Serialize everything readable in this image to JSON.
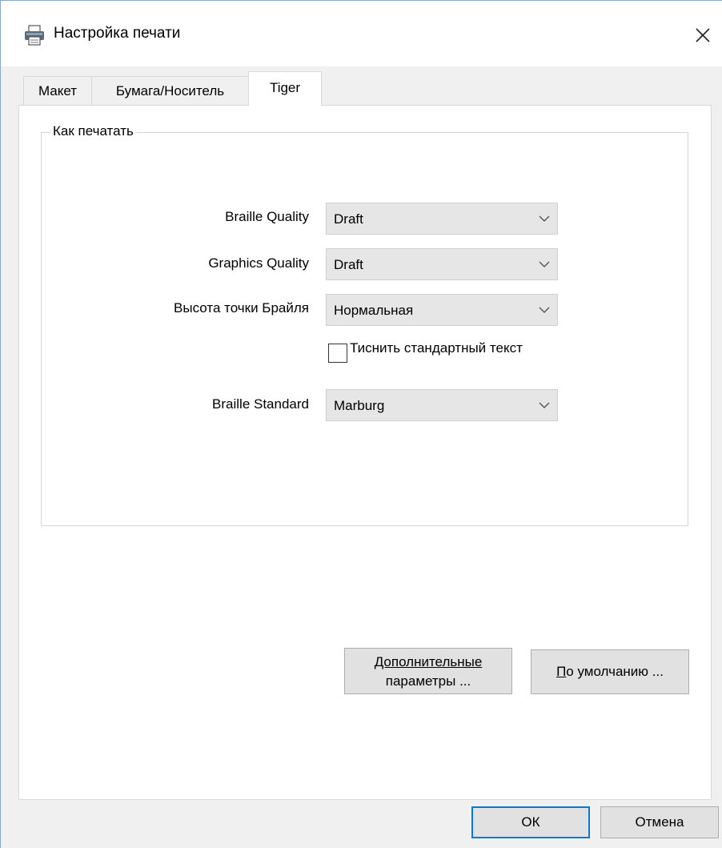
{
  "window": {
    "title": "Настройка печати",
    "title_icon": "printer-icon",
    "close_icon": "close-icon"
  },
  "tabs": [
    {
      "label": "Макет",
      "active": false
    },
    {
      "label": "Бумага/Носитель",
      "active": false
    },
    {
      "label": "Tiger",
      "active": true
    }
  ],
  "group": {
    "title": "Как печатать"
  },
  "fields": {
    "braille_quality": {
      "label": "Braille Quality",
      "value": "Draft"
    },
    "graphics_quality": {
      "label": "Graphics Quality",
      "value": "Draft"
    },
    "dot_height": {
      "label": "Высота точки Брайля",
      "value": "Нормальная"
    },
    "emboss_standard_text": {
      "label": "Тиснить стандартный текст",
      "checked": false
    },
    "braille_standard": {
      "label": "Braille Standard",
      "value": "Marburg"
    }
  },
  "buttons": {
    "advanced_line1": "Дополнительные",
    "advanced_line2": "параметры ...",
    "defaults_first": "П",
    "defaults_rest": "о умолчанию ...",
    "ok": "ОК",
    "cancel": "Отмена"
  },
  "colors": {
    "accent": "#0078d7",
    "dialog_bg": "#f0f0f0",
    "select_bg": "#e6e6e6"
  }
}
